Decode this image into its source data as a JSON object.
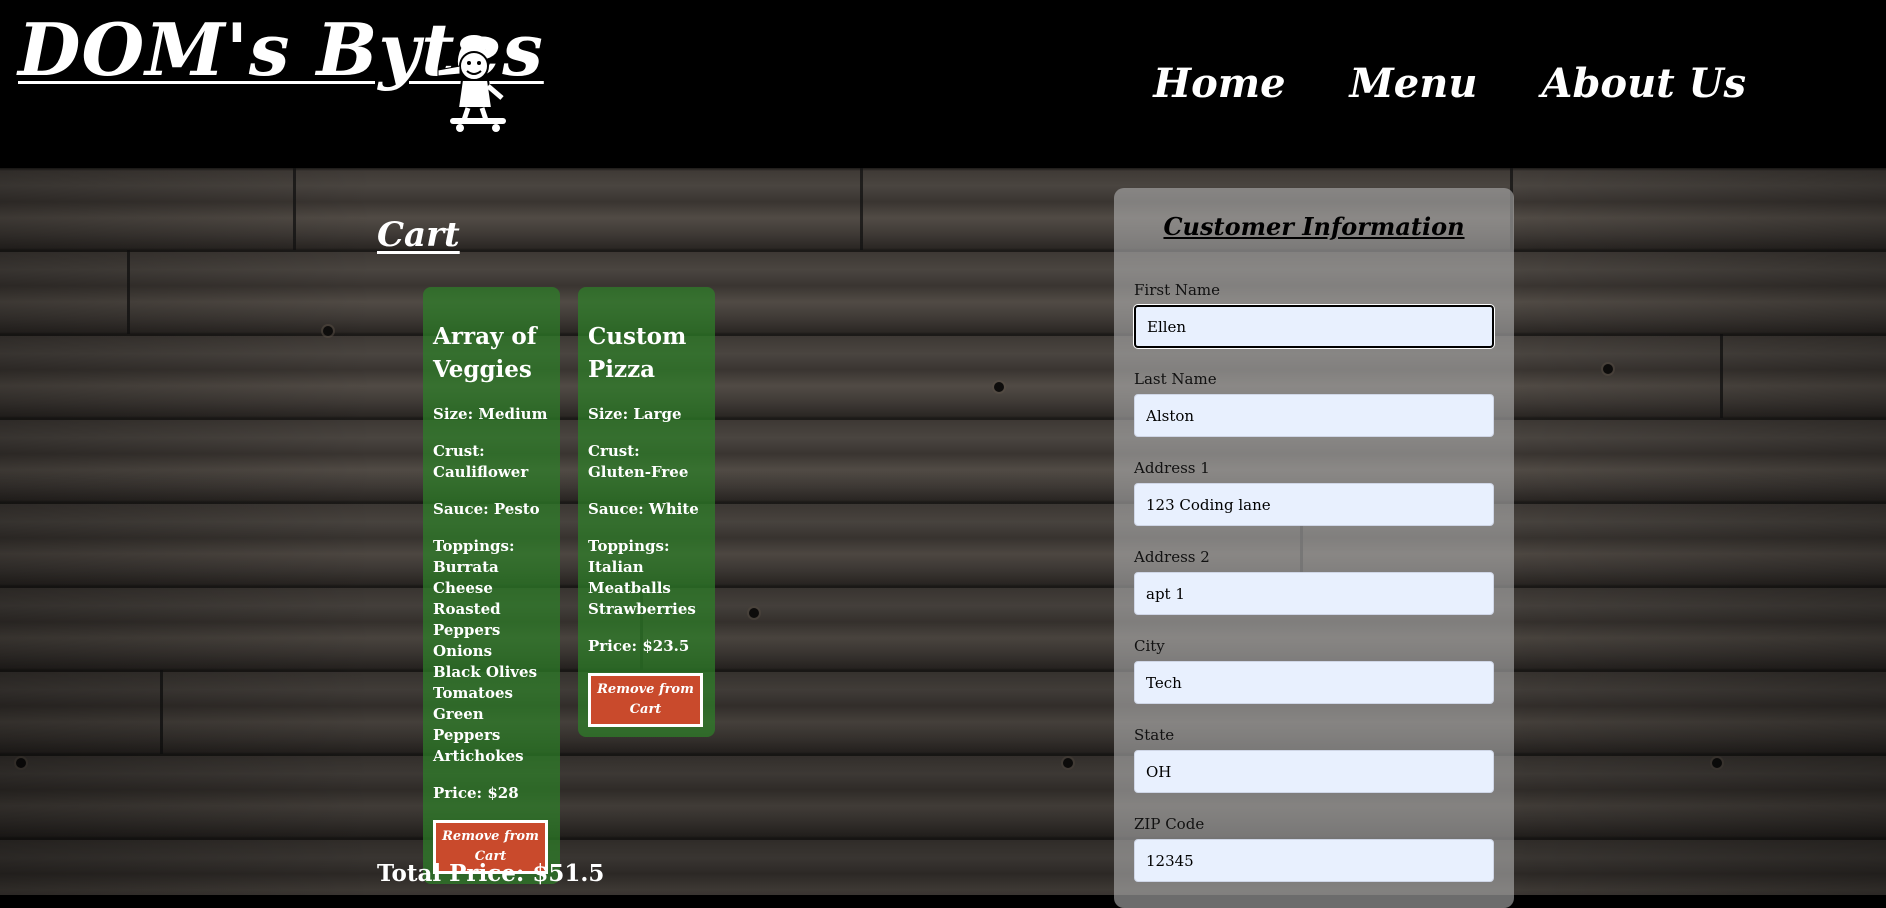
{
  "header": {
    "logo_text": "DOM's Bytes",
    "nav": [
      {
        "label": "Home"
      },
      {
        "label": "Menu"
      },
      {
        "label": "About Us"
      }
    ]
  },
  "cart": {
    "title": "Cart",
    "items": [
      {
        "name": "Array of Veggies",
        "size": "Size: Medium",
        "crust": "Crust: Cauliflower",
        "sauce": "Sauce: Pesto",
        "toppings_label": "Toppings:",
        "toppings": [
          "Burrata Cheese",
          "Roasted Peppers",
          "Onions",
          "Black Olives",
          "Tomatoes",
          "Green Peppers",
          "Artichokes"
        ],
        "price": "Price: $28",
        "remove_label": "Remove from Cart"
      },
      {
        "name": "Custom Pizza",
        "size": "Size: Large",
        "crust": "Crust: Gluten-Free",
        "sauce": "Sauce: White",
        "toppings_label": "Toppings:",
        "toppings": [
          "Italian Meatballs",
          "Strawberries"
        ],
        "price": "Price: $23.5",
        "remove_label": "Remove from Cart"
      }
    ],
    "total": "Total Price: $51.5"
  },
  "customer": {
    "title": "Customer Information",
    "fields": [
      {
        "label": "First Name",
        "value": "Ellen"
      },
      {
        "label": "Last Name",
        "value": "Alston"
      },
      {
        "label": "Address 1",
        "value": "123 Coding lane"
      },
      {
        "label": "Address 2",
        "value": "apt 1"
      },
      {
        "label": "City",
        "value": "Tech"
      },
      {
        "label": "State",
        "value": "OH"
      },
      {
        "label": "ZIP Code",
        "value": "12345"
      }
    ]
  },
  "colors": {
    "card_green": "#2e8028",
    "button_red": "#c94a2c",
    "input_bg": "#e8f0fe"
  }
}
